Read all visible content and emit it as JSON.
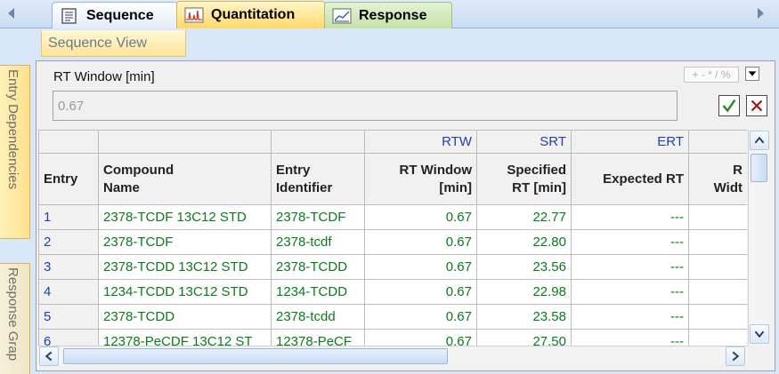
{
  "tabs": [
    {
      "label": "Sequence",
      "icon": "document-icon"
    },
    {
      "label": "Quantitation",
      "icon": "chromatogram-icon",
      "active": true
    },
    {
      "label": "Response",
      "icon": "line-chart-icon"
    }
  ],
  "sequence_view": {
    "label": "Sequence View"
  },
  "side_tabs": {
    "entry_dependencies": "Entry Dependencies",
    "response_graph": "Response Grap"
  },
  "editor": {
    "label": "RT Window [min]",
    "value": "0.67",
    "operators": "+ - * / %"
  },
  "grid": {
    "abbr_row": [
      "",
      "",
      "",
      "RTW",
      "SRT",
      "ERT",
      ""
    ],
    "headers": [
      {
        "line1": "Entry",
        "line2": ""
      },
      {
        "line1": "Compound",
        "line2": "Name"
      },
      {
        "line1": "Entry",
        "line2": "Identifier"
      },
      {
        "line1": "RT Window",
        "line2": "[min]"
      },
      {
        "line1": "Specified",
        "line2": "RT [min]"
      },
      {
        "line1": "Expected RT",
        "line2": ""
      },
      {
        "line1": "R",
        "line2": "Widt"
      }
    ],
    "rows": [
      {
        "entry": "1",
        "compound": "2378-TCDF 13C12 STD",
        "identifier": "2378-TCDF",
        "rtw": "0.67",
        "srt": "22.77",
        "ert": "---"
      },
      {
        "entry": "2",
        "compound": "2378-TCDF",
        "identifier": "2378-tcdf",
        "rtw": "0.67",
        "srt": "22.80",
        "ert": "---"
      },
      {
        "entry": "3",
        "compound": "2378-TCDD 13C12 STD",
        "identifier": "2378-TCDD",
        "rtw": "0.67",
        "srt": "23.56",
        "ert": "---"
      },
      {
        "entry": "4",
        "compound": "1234-TCDD 13C12 STD",
        "identifier": "1234-TCDD",
        "rtw": "0.67",
        "srt": "22.98",
        "ert": "---"
      },
      {
        "entry": "5",
        "compound": "2378-TCDD",
        "identifier": "2378-tcdd",
        "rtw": "0.67",
        "srt": "23.58",
        "ert": "---"
      },
      {
        "entry": "6",
        "compound": "12378-PeCDF 13C12 ST",
        "identifier": "12378-PeCF",
        "rtw": "0.67",
        "srt": "27.50",
        "ert": "---"
      }
    ]
  },
  "colors": {
    "entry_text": "#1d43a8",
    "cell_text": "#0b7a1e",
    "active_tab": "#ffd86a",
    "response_tab": "#c5e1a8"
  }
}
